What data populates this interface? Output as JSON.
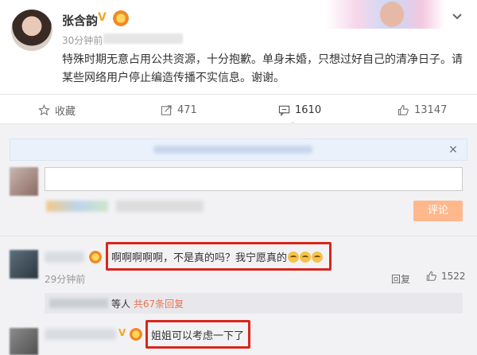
{
  "post": {
    "author": "张含韵",
    "vip_badge": "V",
    "time": "30分钟前",
    "text": "特殊时期无意占用公共资源，十分抱歉。单身未婚，只想过好自己的清净日子。请某些网络用户停止编造传播不实信息。谢谢。"
  },
  "actions": {
    "favorite_label": "收藏",
    "share_count": "471",
    "comment_count": "1610",
    "like_count": "13147"
  },
  "comment_box": {
    "close_glyph": "×",
    "submit_label": "评论"
  },
  "comments": [
    {
      "text": "啊啊啊啊啊，不是真的吗？我宁愿真的",
      "time": "29分钟前",
      "reply_label": "回复",
      "like_count": "1522",
      "reply_summary_prefix": "等人",
      "reply_summary_link": "共67条回复"
    },
    {
      "vip_badge": "V",
      "text": "姐姐可以考虑一下了"
    }
  ],
  "colors": {
    "accent": "#eb7350",
    "highlight": "#d9261c",
    "vip": "#f5a623",
    "submit_bg": "#ffb88c"
  }
}
